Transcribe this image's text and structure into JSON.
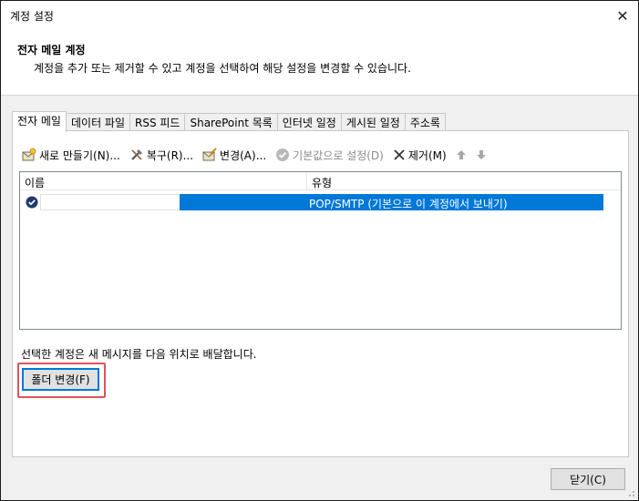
{
  "window": {
    "title": "계정 설정",
    "close_glyph": "✕"
  },
  "header": {
    "title": "전자 메일 계정",
    "description": "계정을 추가 또는 제거할 수 있고 계정을 선택하여 해당 설정을 변경할 수 있습니다."
  },
  "tabs": [
    {
      "label": "전자 메일",
      "active": true
    },
    {
      "label": "데이터 파일"
    },
    {
      "label": "RSS 피드"
    },
    {
      "label": "SharePoint 목록"
    },
    {
      "label": "인터넷 일정"
    },
    {
      "label": "게시된 일정"
    },
    {
      "label": "주소록"
    }
  ],
  "toolbar": {
    "new_label": "새로 만들기(N)...",
    "repair_label": "복구(R)...",
    "change_label": "변경(A)...",
    "default_label": "기본값으로 설정(D)",
    "remove_label": "제거(M)",
    "icons": [
      "new-account-icon",
      "repair-icon",
      "change-icon",
      "check-circle-icon",
      "remove-x-icon",
      "arrow-up-icon",
      "arrow-down-icon"
    ]
  },
  "list": {
    "columns": {
      "name": "이름",
      "type": "유형"
    },
    "rows": [
      {
        "name": "",
        "type": "POP/SMTP (기본으로 이 계정에서 보내기)",
        "selected": true,
        "default": true
      }
    ]
  },
  "deliver_text": "선택한 계정은 새 메시지를 다음 위치로 배달합니다.",
  "folder_button": "폴더 변경(F)",
  "close_button": "닫기(C)",
  "colors": {
    "selection": "#0078d7",
    "highlight": "#e0525a"
  }
}
